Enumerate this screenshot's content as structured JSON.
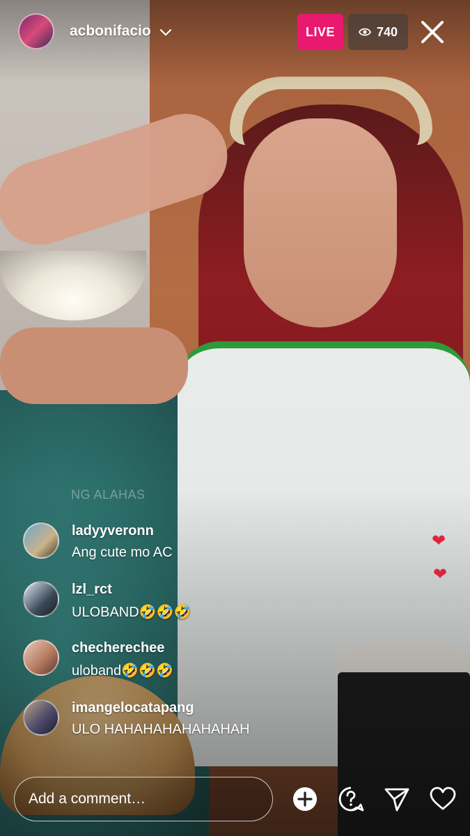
{
  "header": {
    "username": "acbonifacio",
    "live_label": "LIVE",
    "viewer_count": "740"
  },
  "background_text": "NG ALAHAS",
  "comments": [
    {
      "user": "ladyyveronn",
      "text": "Ang cute mo AC"
    },
    {
      "user": "lzl_rct",
      "text": "ULOBAND🤣🤣🤣"
    },
    {
      "user": "checherechee",
      "text": "uloband🤣🤣🤣"
    },
    {
      "user": "imangelocatapang",
      "text": "ULO HAHAHAHAHAHAHAH"
    }
  ],
  "reactions": [
    "❤",
    "❤"
  ],
  "comment_box": {
    "placeholder": "Add a comment…"
  },
  "icons": [
    "add-icon",
    "question-icon",
    "send-icon",
    "heart-icon",
    "eye-icon",
    "close-icon",
    "chevron-down-icon"
  ],
  "colors": {
    "live_badge": "#e8196f",
    "heart": "#e0233c"
  }
}
